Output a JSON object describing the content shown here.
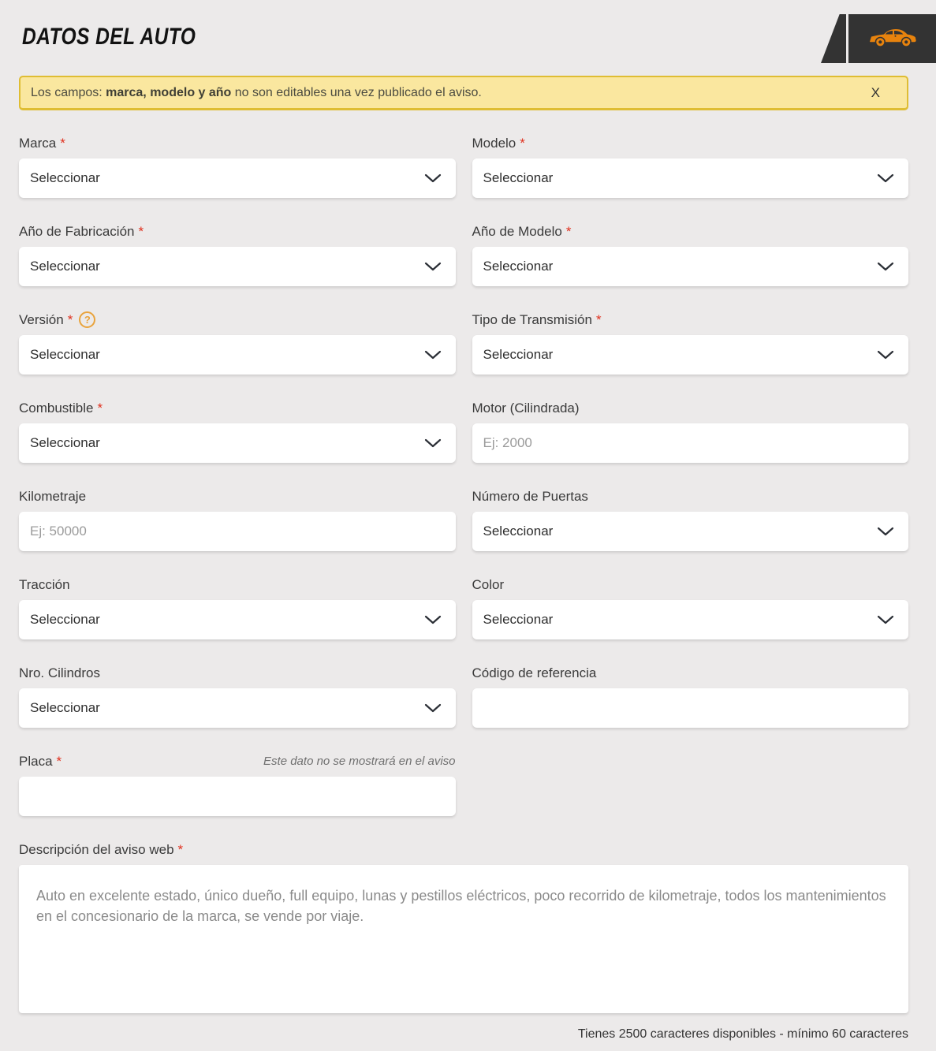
{
  "colors": {
    "page_bg": "#ECEAEA",
    "accent_orange": "#E8830D",
    "badge_bg": "#333333",
    "banner_bg": "#FAE79F",
    "banner_border": "#DFBD33",
    "required_red": "#E0301E"
  },
  "symbols": {
    "required": "*",
    "help": "?"
  },
  "header": {
    "title": "DATOS DEL AUTO",
    "icon": "car-icon"
  },
  "banner": {
    "prefix": "Los campos: ",
    "bold": "marca, modelo y año",
    "suffix": " no son editables una vez publicado el aviso.",
    "close": "X"
  },
  "form": {
    "marca": {
      "label": "Marca",
      "value": "Seleccionar"
    },
    "modelo": {
      "label": "Modelo",
      "value": "Seleccionar"
    },
    "anio_fabricacion": {
      "label": "Año de Fabricación",
      "value": "Seleccionar"
    },
    "anio_modelo": {
      "label": "Año de Modelo",
      "value": "Seleccionar"
    },
    "version": {
      "label": "Versión",
      "value": "Seleccionar"
    },
    "transmision": {
      "label": "Tipo de Transmisión",
      "value": "Seleccionar"
    },
    "combustible": {
      "label": "Combustible",
      "value": "Seleccionar"
    },
    "motor": {
      "label": "Motor (Cilindrada)",
      "placeholder": "Ej: 2000",
      "value": ""
    },
    "kilometraje": {
      "label": "Kilometraje",
      "placeholder": "Ej: 50000",
      "value": ""
    },
    "puertas": {
      "label": "Número de Puertas",
      "value": "Seleccionar"
    },
    "traccion": {
      "label": "Tracción",
      "value": "Seleccionar"
    },
    "color": {
      "label": "Color",
      "value": "Seleccionar"
    },
    "cilindros": {
      "label": "Nro. Cilindros",
      "value": "Seleccionar"
    },
    "codigo_referencia": {
      "label": "Código de referencia",
      "value": ""
    },
    "placa": {
      "label": "Placa",
      "note": "Este dato no se mostrará en el aviso",
      "value": ""
    },
    "descripcion": {
      "label": "Descripción del aviso web",
      "value": "Auto en excelente estado, único dueño, full equipo, lunas y pestillos eléctricos, poco recorrido de kilometraje, todos los mantenimientos en el concesionario de la marca, se vende por viaje.",
      "counter": "Tienes 2500 caracteres disponibles - mínimo 60 caracteres"
    }
  }
}
